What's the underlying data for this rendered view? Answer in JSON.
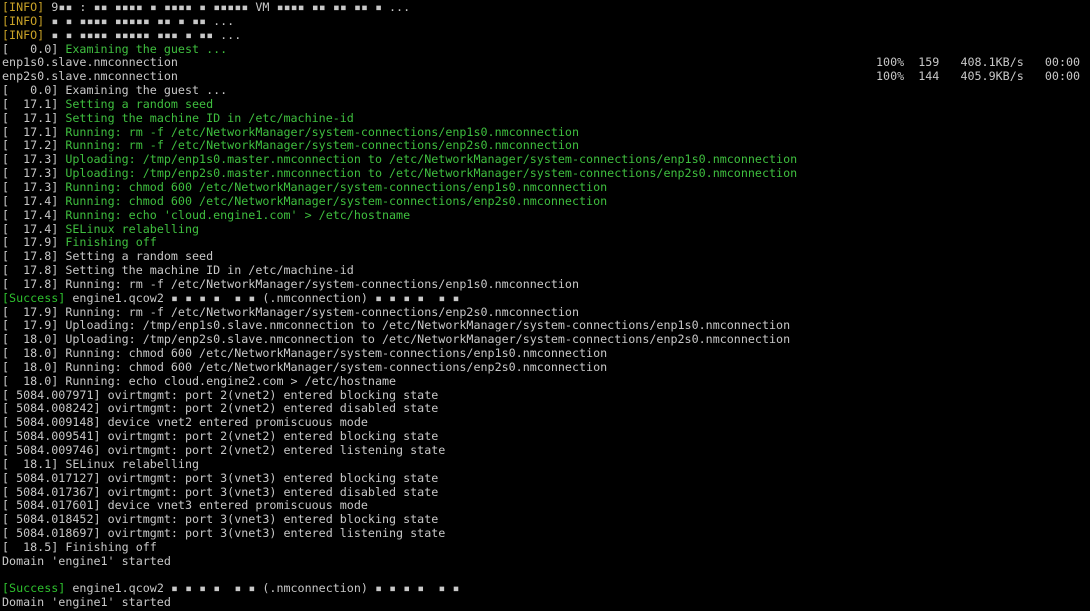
{
  "terminal": {
    "colors": {
      "background": "#000000",
      "text": "#c8c8c8",
      "green": "#3fbf3f",
      "info": "#c9a227",
      "success": "#2ec02e"
    },
    "lines": [
      {
        "tag": "[INFO]",
        "tag_type": "info",
        "text": " 9▪▪ : ▪▪ ▪▪▪▪ ▪ ▪▪▪▪ ▪ ▪▪▪▪▪ VM ▪▪▪▪ ▪▪ ▪▪ ▪▪ ▪ ...",
        "color": "gray"
      },
      {
        "tag": "[INFO]",
        "tag_type": "info",
        "text": " ▪ ▪ ▪▪▪▪ ▪▪▪▪▪ ▪▪ ▪ ▪▪ ...",
        "color": "gray"
      },
      {
        "tag": "[INFO]",
        "tag_type": "info",
        "text": " ▪ ▪ ▪▪▪▪ ▪▪▪▪▪ ▪▪▪ ▪ ▪▪ ...",
        "color": "gray"
      },
      {
        "prefix": "[   0.0] ",
        "text": "Examining the guest ...",
        "color": "green"
      },
      {
        "text": "enp1s0.slave.nmconnection",
        "color": "gray",
        "stats": "100%  159   408.1KB/s   00:00"
      },
      {
        "text": "enp2s0.slave.nmconnection",
        "color": "gray",
        "stats": "100%  144   405.9KB/s   00:00"
      },
      {
        "prefix": "[   0.0] ",
        "text": "Examining the guest ...",
        "color": "gray"
      },
      {
        "prefix": "[  17.1] ",
        "text": "Setting a random seed",
        "color": "green"
      },
      {
        "prefix": "[  17.1] ",
        "text": "Setting the machine ID in /etc/machine-id",
        "color": "green"
      },
      {
        "prefix": "[  17.1] ",
        "text": "Running: rm -f /etc/NetworkManager/system-connections/enp1s0.nmconnection",
        "color": "green"
      },
      {
        "prefix": "[  17.2] ",
        "text": "Running: rm -f /etc/NetworkManager/system-connections/enp2s0.nmconnection",
        "color": "green"
      },
      {
        "prefix": "[  17.3] ",
        "text": "Uploading: /tmp/enp1s0.master.nmconnection to /etc/NetworkManager/system-connections/enp1s0.nmconnection",
        "color": "green"
      },
      {
        "prefix": "[  17.3] ",
        "text": "Uploading: /tmp/enp2s0.master.nmconnection to /etc/NetworkManager/system-connections/enp2s0.nmconnection",
        "color": "green"
      },
      {
        "prefix": "[  17.3] ",
        "text": "Running: chmod 600 /etc/NetworkManager/system-connections/enp1s0.nmconnection",
        "color": "green"
      },
      {
        "prefix": "[  17.4] ",
        "text": "Running: chmod 600 /etc/NetworkManager/system-connections/enp2s0.nmconnection",
        "color": "green"
      },
      {
        "prefix": "[  17.4] ",
        "text": "Running: echo 'cloud.engine1.com' > /etc/hostname",
        "color": "green"
      },
      {
        "prefix": "[  17.4] ",
        "text": "SELinux relabelling",
        "color": "green"
      },
      {
        "prefix": "[  17.9] ",
        "text": "Finishing off",
        "color": "green"
      },
      {
        "prefix": "[  17.8] ",
        "text": "Setting a random seed",
        "color": "gray"
      },
      {
        "prefix": "[  17.8] ",
        "text": "Setting the machine ID in /etc/machine-id",
        "color": "gray"
      },
      {
        "prefix": "[  17.8] ",
        "text": "Running: rm -f /etc/NetworkManager/system-connections/enp1s0.nmconnection",
        "color": "gray"
      },
      {
        "tag": "[Success]",
        "tag_type": "success",
        "text": " engine1.qcow2 ▪ ▪ ▪ ▪  ▪ ▪ (.nmconnection) ▪ ▪ ▪ ▪  ▪ ▪",
        "color": "gray"
      },
      {
        "prefix": "[  17.9] ",
        "text": "Running: rm -f /etc/NetworkManager/system-connections/enp2s0.nmconnection",
        "color": "gray"
      },
      {
        "prefix": "[  17.9] ",
        "text": "Uploading: /tmp/enp1s0.slave.nmconnection to /etc/NetworkManager/system-connections/enp1s0.nmconnection",
        "color": "gray"
      },
      {
        "prefix": "[  18.0] ",
        "text": "Uploading: /tmp/enp2s0.slave.nmconnection to /etc/NetworkManager/system-connections/enp2s0.nmconnection",
        "color": "gray"
      },
      {
        "prefix": "[  18.0] ",
        "text": "Running: chmod 600 /etc/NetworkManager/system-connections/enp1s0.nmconnection",
        "color": "gray"
      },
      {
        "prefix": "[  18.0] ",
        "text": "Running: chmod 600 /etc/NetworkManager/system-connections/enp2s0.nmconnection",
        "color": "gray"
      },
      {
        "prefix": "[  18.0] ",
        "text": "Running: echo cloud.engine2.com > /etc/hostname",
        "color": "gray"
      },
      {
        "prefix": "[ 5084.007971] ",
        "text": "ovirtmgmt: port 2(vnet2) entered blocking state",
        "color": "gray"
      },
      {
        "prefix": "[ 5084.008242] ",
        "text": "ovirtmgmt: port 2(vnet2) entered disabled state",
        "color": "gray"
      },
      {
        "prefix": "[ 5084.009148] ",
        "text": "device vnet2 entered promiscuous mode",
        "color": "gray"
      },
      {
        "prefix": "[ 5084.009541] ",
        "text": "ovirtmgmt: port 2(vnet2) entered blocking state",
        "color": "gray"
      },
      {
        "prefix": "[ 5084.009746] ",
        "text": "ovirtmgmt: port 2(vnet2) entered listening state",
        "color": "gray"
      },
      {
        "prefix": "[  18.1] ",
        "text": "SELinux relabelling",
        "color": "gray"
      },
      {
        "prefix": "[ 5084.017127] ",
        "text": "ovirtmgmt: port 3(vnet3) entered blocking state",
        "color": "gray"
      },
      {
        "prefix": "[ 5084.017367] ",
        "text": "ovirtmgmt: port 3(vnet3) entered disabled state",
        "color": "gray"
      },
      {
        "prefix": "[ 5084.017601] ",
        "text": "device vnet3 entered promiscuous mode",
        "color": "gray"
      },
      {
        "prefix": "[ 5084.018452] ",
        "text": "ovirtmgmt: port 3(vnet3) entered blocking state",
        "color": "gray"
      },
      {
        "prefix": "[ 5084.018697] ",
        "text": "ovirtmgmt: port 3(vnet3) entered listening state",
        "color": "gray"
      },
      {
        "prefix": "[  18.5] ",
        "text": "Finishing off",
        "color": "gray"
      },
      {
        "text": "Domain 'engine1' started",
        "color": "gray"
      },
      {
        "text": "",
        "color": "gray"
      },
      {
        "tag": "[Success]",
        "tag_type": "success",
        "text": " engine1.qcow2 ▪ ▪ ▪ ▪  ▪ ▪ (.nmconnection) ▪ ▪ ▪ ▪  ▪ ▪",
        "color": "gray"
      },
      {
        "text": "Domain 'engine1' started",
        "color": "gray"
      }
    ]
  }
}
